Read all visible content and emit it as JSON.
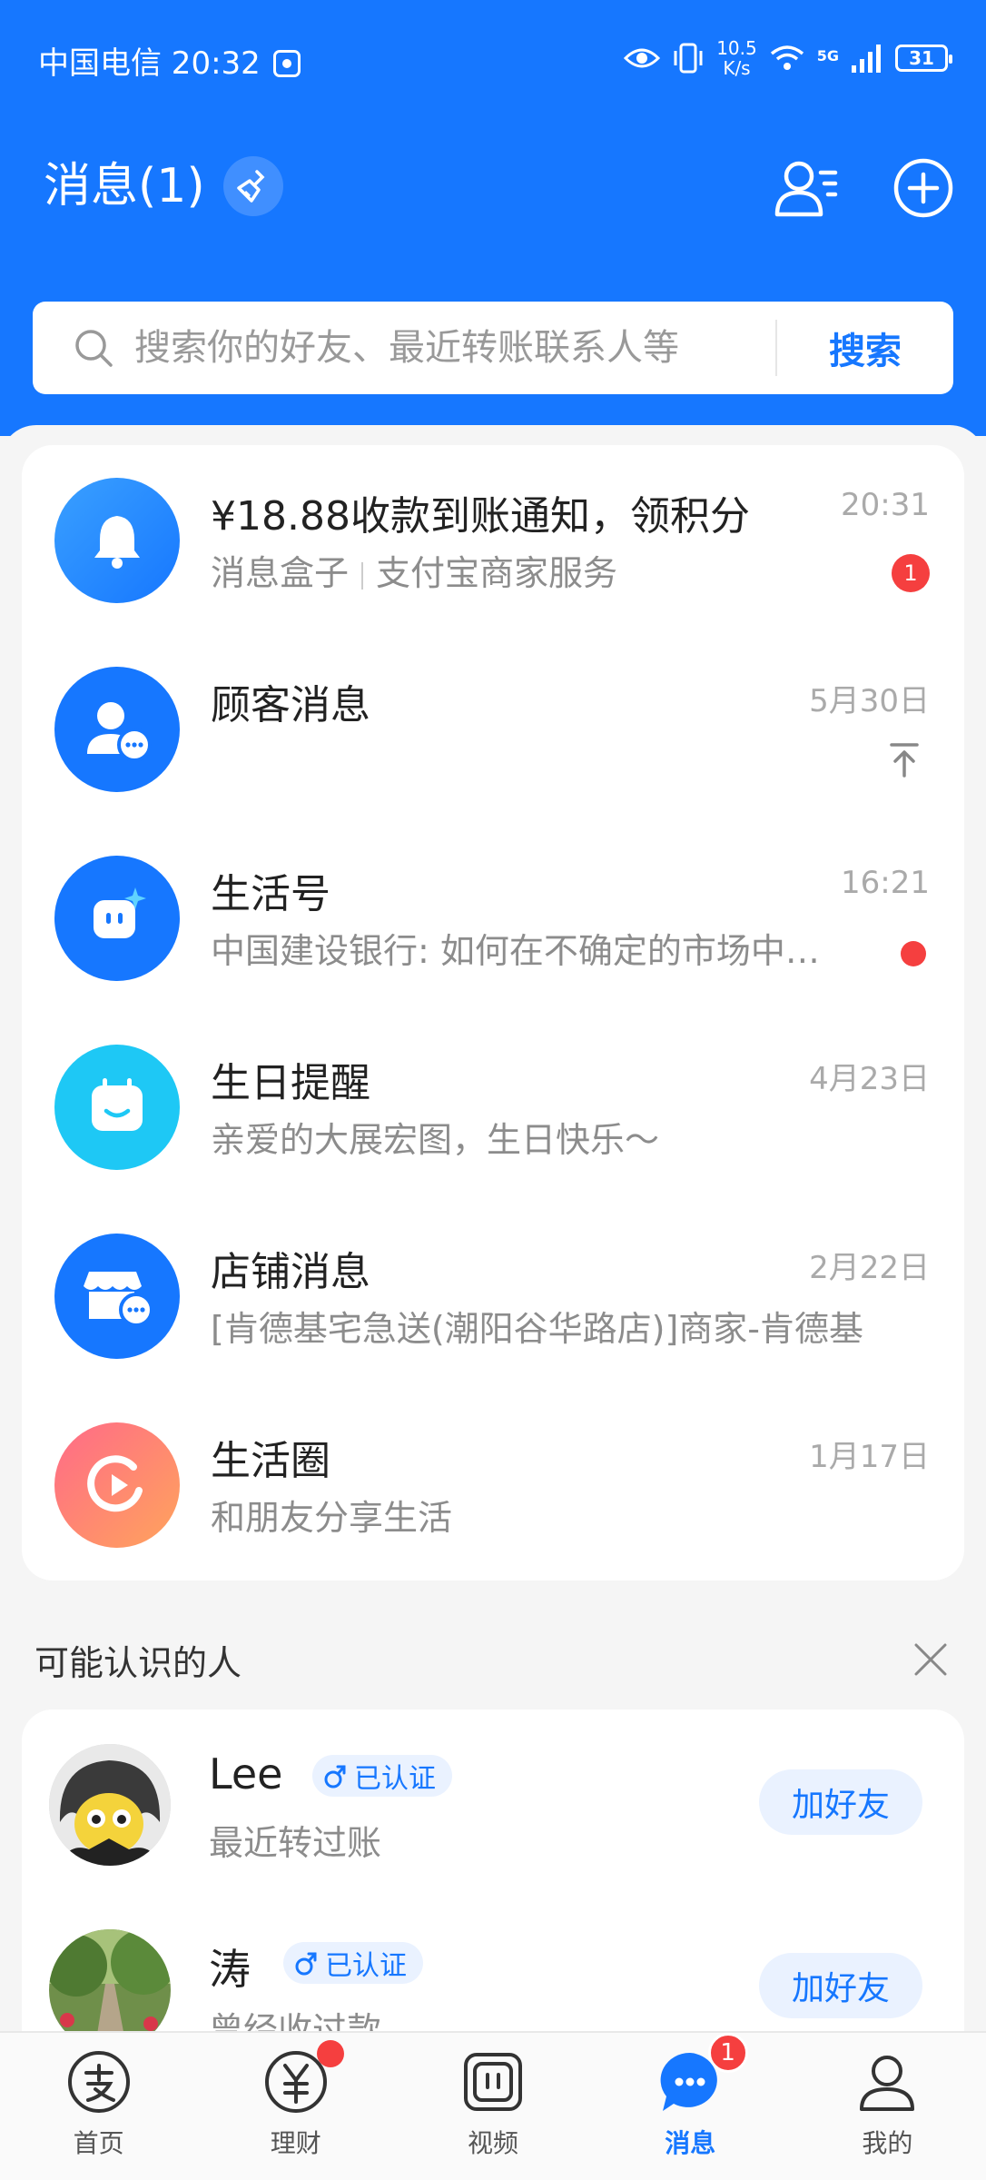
{
  "status_bar": {
    "carrier_time": "中国电信 20:32",
    "speed_value": "10.5",
    "speed_unit": "K/s",
    "network": "5G",
    "battery": "31"
  },
  "header": {
    "title": "消息(1)",
    "broom_icon": "broom-icon",
    "contacts_icon": "contacts-icon",
    "add_icon": "add-circle-icon"
  },
  "search": {
    "placeholder": "搜索你的好友、最近转账联系人等",
    "button": "搜索"
  },
  "messages": [
    {
      "title": "¥18.88收款到账通知，领积分",
      "sub_a": "消息盒子",
      "sub_b": "支付宝商家服务",
      "time": "20:31",
      "badge": "1",
      "icon": "bell-icon"
    },
    {
      "title": "顾客消息",
      "sub": "",
      "time": "5月30日",
      "pinned": true,
      "icon": "customer-chat-icon"
    },
    {
      "title": "生活号",
      "sub": "中国建设银行: 如何在不确定的市场中寻找确定性",
      "time": "16:21",
      "dot": true,
      "icon": "lifestyle-icon"
    },
    {
      "title": "生日提醒",
      "sub": "亲爱的大展宏图，生日快乐～",
      "time": "4月23日",
      "icon": "calendar-icon"
    },
    {
      "title": "店铺消息",
      "sub": "[肯德基宅急送(潮阳谷华路店)]商家-肯德基",
      "time": "2月22日",
      "icon": "store-icon"
    },
    {
      "title": "生活圈",
      "sub": "和朋友分享生活",
      "time": "1月17日",
      "icon": "life-circle-icon"
    }
  ],
  "people_known": {
    "header": "可能认识的人",
    "people": [
      {
        "name": "Lee",
        "verify": "已认证",
        "reason": "最近转过账",
        "button": "加好友"
      },
      {
        "name": "涛",
        "verify": "已认证",
        "reason": "曾经收过款",
        "button": "加好友"
      }
    ]
  },
  "tabs": [
    {
      "label": "首页",
      "icon": "alipay-icon"
    },
    {
      "label": "理财",
      "icon": "wealth-icon",
      "dot": true
    },
    {
      "label": "视频",
      "icon": "video-icon"
    },
    {
      "label": "消息",
      "icon": "message-icon",
      "active": true,
      "badge": "1"
    },
    {
      "label": "我的",
      "icon": "profile-icon"
    }
  ],
  "colors": {
    "brand": "#1677ff",
    "badge": "#f53f3f",
    "background": "#f5f5f5"
  }
}
